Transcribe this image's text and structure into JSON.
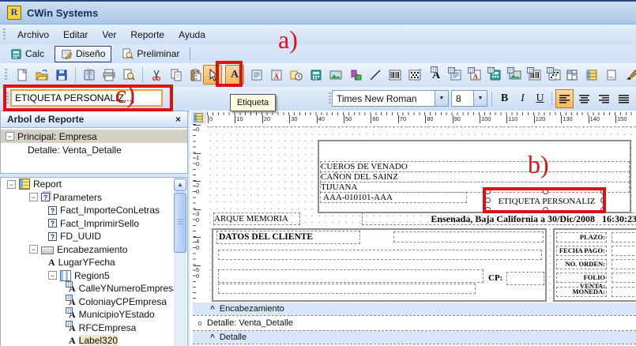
{
  "window": {
    "title": "CWin Systems",
    "icon_letter": "R"
  },
  "menu": {
    "items": [
      "Archivo",
      "Editar",
      "Ver",
      "Reporte",
      "Ayuda"
    ]
  },
  "tabs": [
    {
      "label": "Calc"
    },
    {
      "label": "Diseño"
    },
    {
      "label": "Preliminar"
    }
  ],
  "name_input": {
    "value": "ETIQUETA PERSONALIZ..."
  },
  "tooltip": "Etiqueta",
  "format": {
    "font": "Times New Roman",
    "size": "8",
    "bold": "B",
    "italic": "I",
    "underline": "U"
  },
  "annotations": {
    "a": "a)",
    "b": "b)",
    "c": "c)"
  },
  "tree_panel": {
    "title": "Arbol de Reporte",
    "close": "×",
    "items": [
      {
        "label": "Principal: Empresa"
      },
      {
        "label": "Detalle: Venta_Detalle"
      }
    ]
  },
  "object_tree": [
    {
      "label": "Report",
      "icon": "table",
      "lvl": 0,
      "tgl": true
    },
    {
      "label": "Parameters",
      "icon": "params",
      "lvl": 1,
      "tgl": true
    },
    {
      "label": "Fact_ImporteConLetras",
      "icon": "param",
      "lvl": 2
    },
    {
      "label": "Fact_ImprimirSello",
      "icon": "param",
      "lvl": 2
    },
    {
      "label": "FD_UUID",
      "icon": "param",
      "lvl": 2
    },
    {
      "label": "Encabezamiento",
      "icon": "band",
      "lvl": 1,
      "tgl": true
    },
    {
      "label": "LugarYFecha",
      "icon": "text",
      "lvl": 2
    },
    {
      "label": "Region5",
      "icon": "region",
      "lvl": 2,
      "tgl": true
    },
    {
      "label": "CalleYNumeroEmpresa",
      "icon": "dbtext",
      "lvl": 3
    },
    {
      "label": "ColoniayCPEmpresa",
      "icon": "dbtext",
      "lvl": 3
    },
    {
      "label": "MunicipioYEstado",
      "icon": "dbtext",
      "lvl": 3
    },
    {
      "label": "RFCEmpresa",
      "icon": "dbtext",
      "lvl": 3
    },
    {
      "label": "Label320",
      "icon": "text",
      "lvl": 3,
      "selected": true
    }
  ],
  "design": {
    "ruler_h": [
      "0",
      "10",
      "20",
      "30",
      "40",
      "50",
      "60",
      "70",
      "80",
      "90",
      "100",
      "110",
      "120",
      "130",
      "140",
      "150"
    ],
    "ruler_v": [
      "0",
      "10",
      "20",
      "30",
      "40",
      "50"
    ],
    "company_lines": [
      "CUEROS DE VENADO",
      "CAÑON DEL SAINZ",
      "TIJUANA",
      "AAA-010101-AAA"
    ],
    "etiqueta_text": "ETIQUETA PERSONALIZ",
    "memoria_text": "ARQUE MEMORIA",
    "place_date": "Ensenada, Baja California a 30/Dic/2008   16:30:23",
    "client_title": "DATOS DEL CLIENTE",
    "cp_label": "CP:",
    "right_fields": [
      "PLAZO:",
      "FECHA PAGO:",
      "NO. ORDEN:",
      "FOLIO VENTA:",
      "MONEDA:"
    ],
    "bands": {
      "enc": "Encabezamiento",
      "detalle_band": "Detalle: Venta_Detalle",
      "det": "Detalle",
      "zero": "0"
    }
  },
  "colors": {
    "accent_red": "#dd1111",
    "highlight_orange": "#fcb659",
    "tooltip_bg": "#ffffe1"
  }
}
